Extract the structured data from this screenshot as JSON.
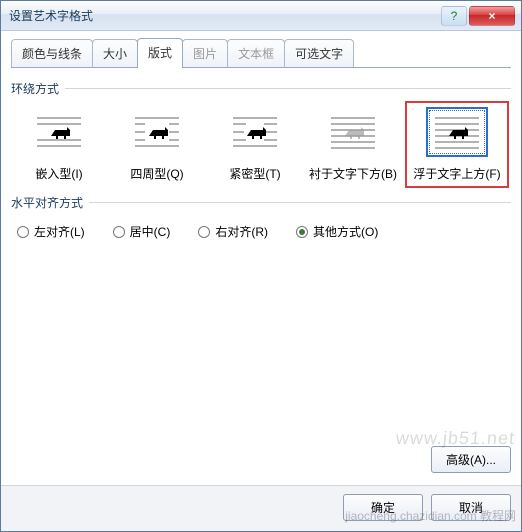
{
  "window": {
    "title": "设置艺术字格式",
    "help": "?",
    "close": "×"
  },
  "tabs": [
    {
      "label": "颜色与线条",
      "active": false,
      "disabled": false
    },
    {
      "label": "大小",
      "active": false,
      "disabled": false
    },
    {
      "label": "版式",
      "active": true,
      "disabled": false
    },
    {
      "label": "图片",
      "active": false,
      "disabled": true
    },
    {
      "label": "文本框",
      "active": false,
      "disabled": true
    },
    {
      "label": "可选文字",
      "active": false,
      "disabled": false
    }
  ],
  "groups": {
    "wrap_title": "环绕方式",
    "align_title": "水平对齐方式"
  },
  "wrap_options": [
    {
      "label": "嵌入型(I)",
      "selected": false
    },
    {
      "label": "四周型(Q)",
      "selected": false
    },
    {
      "label": "紧密型(T)",
      "selected": false
    },
    {
      "label": "衬于文字下方(B)",
      "selected": false
    },
    {
      "label": "浮于文字上方(F)",
      "selected": true
    }
  ],
  "align_options": [
    {
      "label": "左对齐(L)",
      "checked": false
    },
    {
      "label": "居中(C)",
      "checked": false
    },
    {
      "label": "右对齐(R)",
      "checked": false
    },
    {
      "label": "其他方式(O)",
      "checked": true
    }
  ],
  "buttons": {
    "advanced": "高级(A)...",
    "ok": "确定",
    "cancel": "取消"
  },
  "watermark": {
    "line1": "www.jb51.net",
    "line2": "jiaocheng.chazidian.com 教程网"
  }
}
